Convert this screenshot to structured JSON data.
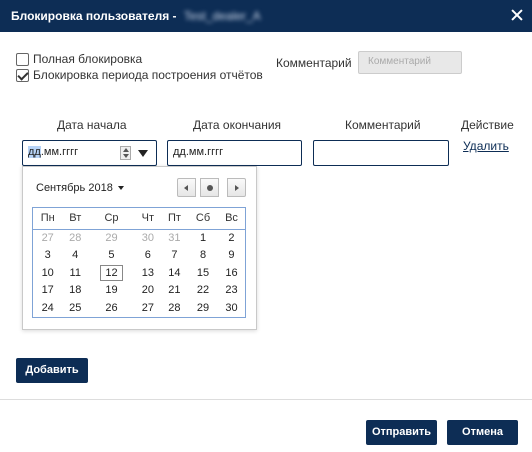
{
  "dialog": {
    "title": "Блокировка пользователя -",
    "user_name": "Test_dealer_A"
  },
  "options": {
    "full_block_label": "Полная блокировка",
    "full_block_checked": false,
    "report_block_label": "Блокировка периода построения отчётов",
    "report_block_checked": true
  },
  "comment_top": {
    "label": "Комментарий",
    "placeholder": "Комментарий"
  },
  "table": {
    "headers": [
      "Дата начала",
      "Дата окончания",
      "Комментарий",
      "Действие"
    ],
    "start_date_placeholder": "дд.мм.гггг",
    "start_date_sel": "дд",
    "start_date_rest": ".мм.гггг",
    "end_date_placeholder": "дд.мм.гггг",
    "comment_value": "",
    "action_link": "Удалить"
  },
  "calendar": {
    "month_label": "Сентябрь 2018",
    "weekdays": [
      "Пн",
      "Вт",
      "Ср",
      "Чт",
      "Пт",
      "Сб",
      "Вс"
    ],
    "weeks": [
      [
        "27",
        "28",
        "29",
        "30",
        "31",
        "1",
        "2"
      ],
      [
        "3",
        "4",
        "5",
        "6",
        "7",
        "8",
        "9"
      ],
      [
        "10",
        "11",
        "12",
        "13",
        "14",
        "15",
        "16"
      ],
      [
        "17",
        "18",
        "19",
        "20",
        "21",
        "22",
        "23"
      ],
      [
        "24",
        "25",
        "26",
        "27",
        "28",
        "29",
        "30"
      ]
    ],
    "muted_days_first_row": 5,
    "today": "12"
  },
  "buttons": {
    "add": "Добавить",
    "submit": "Отправить",
    "cancel": "Отмена"
  },
  "colors": {
    "primary": "#0d2d55",
    "selection": "#b7d3f6"
  }
}
